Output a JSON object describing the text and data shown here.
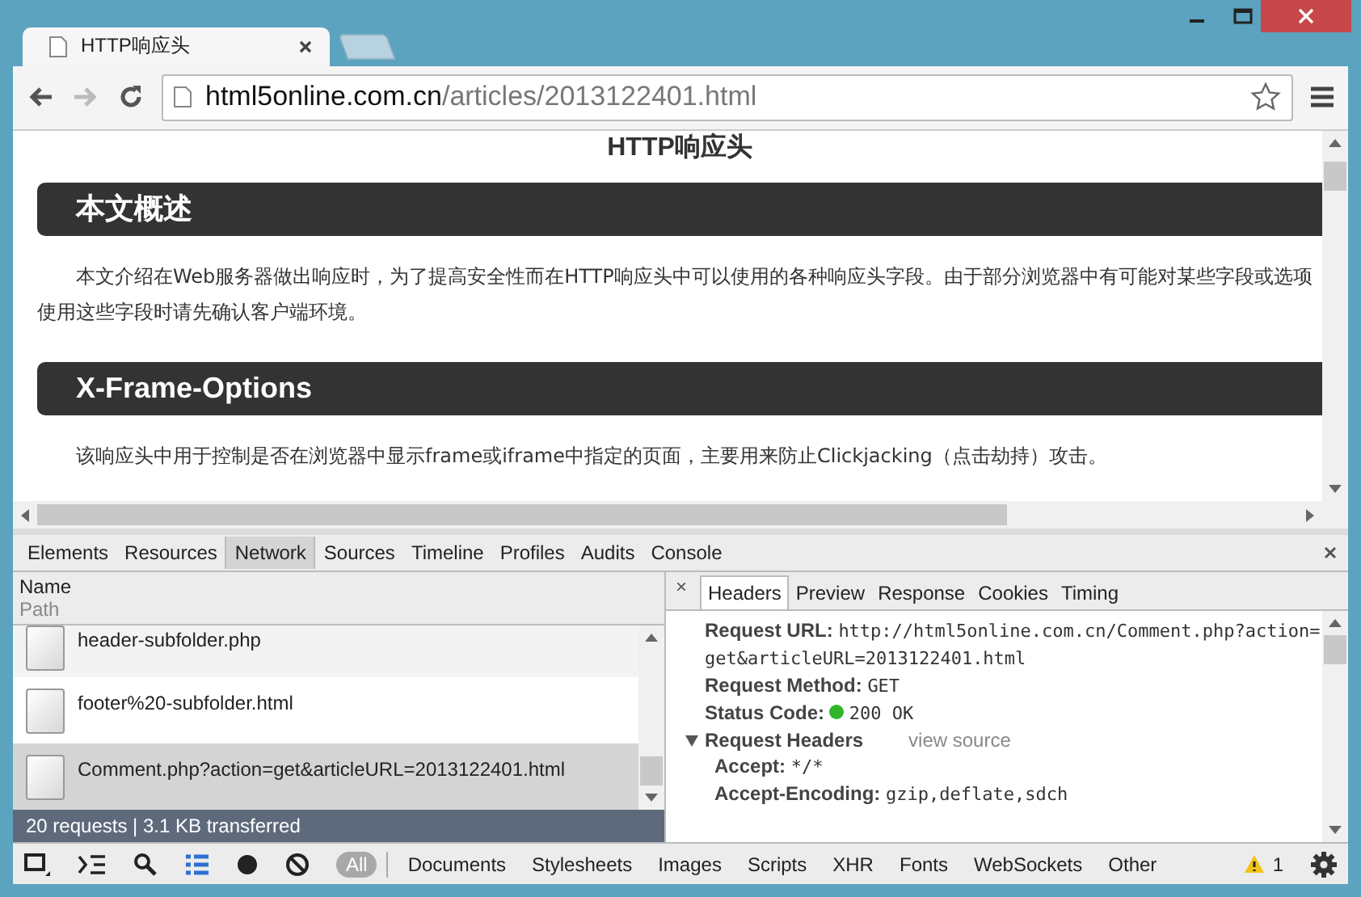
{
  "window": {
    "tab_title": "HTTP响应头",
    "url_host": "html5online.com.cn",
    "url_path": "/articles/2013122401.html"
  },
  "page": {
    "title": "HTTP响应头",
    "sections": [
      {
        "heading": "本文概述",
        "lines": [
          "本文介绍在Web服务器做出响应时，为了提高安全性而在HTTP响应头中可以使用的各种响应头字段。由于部分浏览器中有可能对某些字段或选项",
          "使用这些字段时请先确认客户端环境。"
        ]
      },
      {
        "heading": "X-Frame-Options",
        "lines": [
          "该响应头中用于控制是否在浏览器中显示frame或iframe中指定的页面，主要用来防止Clickjacking（点击劫持）攻击。"
        ]
      }
    ]
  },
  "devtools": {
    "panels": [
      {
        "label": "Elements",
        "selected": false
      },
      {
        "label": "Resources",
        "selected": false
      },
      {
        "label": "Network",
        "selected": true
      },
      {
        "label": "Sources",
        "selected": false
      },
      {
        "label": "Timeline",
        "selected": false
      },
      {
        "label": "Profiles",
        "selected": false
      },
      {
        "label": "Audits",
        "selected": false
      },
      {
        "label": "Console",
        "selected": false
      }
    ],
    "network": {
      "column_title": "Name",
      "column_subtitle": "Path",
      "rows": [
        {
          "name": "header-subfolder.php",
          "selected": false
        },
        {
          "name": "footer%20-subfolder.html",
          "selected": false
        },
        {
          "name": "Comment.php?action=get&articleURL=2013122401.html",
          "selected": true
        }
      ],
      "summary": "20 requests | 3.1 KB transferred"
    },
    "detail_close": "×",
    "detail_tabs": [
      {
        "label": "Headers",
        "selected": true
      },
      {
        "label": "Preview",
        "selected": false
      },
      {
        "label": "Response",
        "selected": false
      },
      {
        "label": "Cookies",
        "selected": false
      },
      {
        "label": "Timing",
        "selected": false
      }
    ],
    "general": [
      {
        "kind": "plain",
        "key": "Request URL:",
        "value": "http://html5online.com.cn/Comment.php?action=get&articleURL=2013122401.html"
      },
      {
        "kind": "plain",
        "key": "Request Method:",
        "value": "GET"
      },
      {
        "kind": "status",
        "key": "Status Code:",
        "value": "200 OK"
      }
    ],
    "request_headers": {
      "title": "Request Headers",
      "expanded": true,
      "link": "view source",
      "items": [
        {
          "key": "Accept:",
          "value": "*/*"
        },
        {
          "key": "Accept-Encoding:",
          "value": "gzip,deflate,sdch"
        }
      ]
    },
    "filters": [
      {
        "label": "All",
        "selected": true
      },
      {
        "label": "Documents",
        "selected": false
      },
      {
        "label": "Stylesheets",
        "selected": false
      },
      {
        "label": "Images",
        "selected": false
      },
      {
        "label": "Scripts",
        "selected": false
      },
      {
        "label": "XHR",
        "selected": false
      },
      {
        "label": "Fonts",
        "selected": false
      },
      {
        "label": "WebSockets",
        "selected": false
      },
      {
        "label": "Other",
        "selected": false
      }
    ],
    "warnings": "1"
  }
}
